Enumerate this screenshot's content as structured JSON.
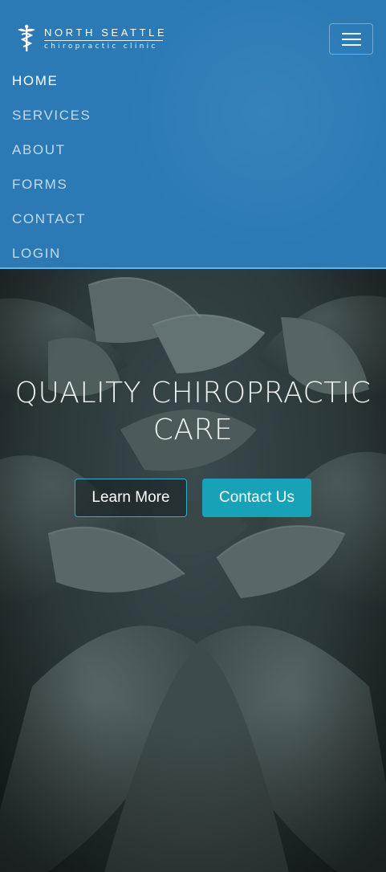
{
  "brand": {
    "name_line1": "NORTH SEATTLE",
    "name_line2": "chiropractic clinic"
  },
  "nav": {
    "toggle_icon": "hamburger-menu-icon",
    "items": [
      {
        "label": "HOME",
        "active": true
      },
      {
        "label": "SERVICES",
        "active": false
      },
      {
        "label": "ABOUT",
        "active": false
      },
      {
        "label": "FORMS",
        "active": false
      },
      {
        "label": "CONTACT",
        "active": false
      },
      {
        "label": "LOGIN",
        "active": false
      }
    ]
  },
  "hero": {
    "title_line1": "QUALITY CHIROPRACTIC",
    "title_line2": "CARE",
    "learn_more_label": "Learn More",
    "contact_label": "Contact Us"
  },
  "colors": {
    "navbar_bg": "#2b7ab5",
    "navbar_border": "#5fb6e0",
    "accent": "#17a2b8",
    "hero_bg": "#2b3739"
  }
}
